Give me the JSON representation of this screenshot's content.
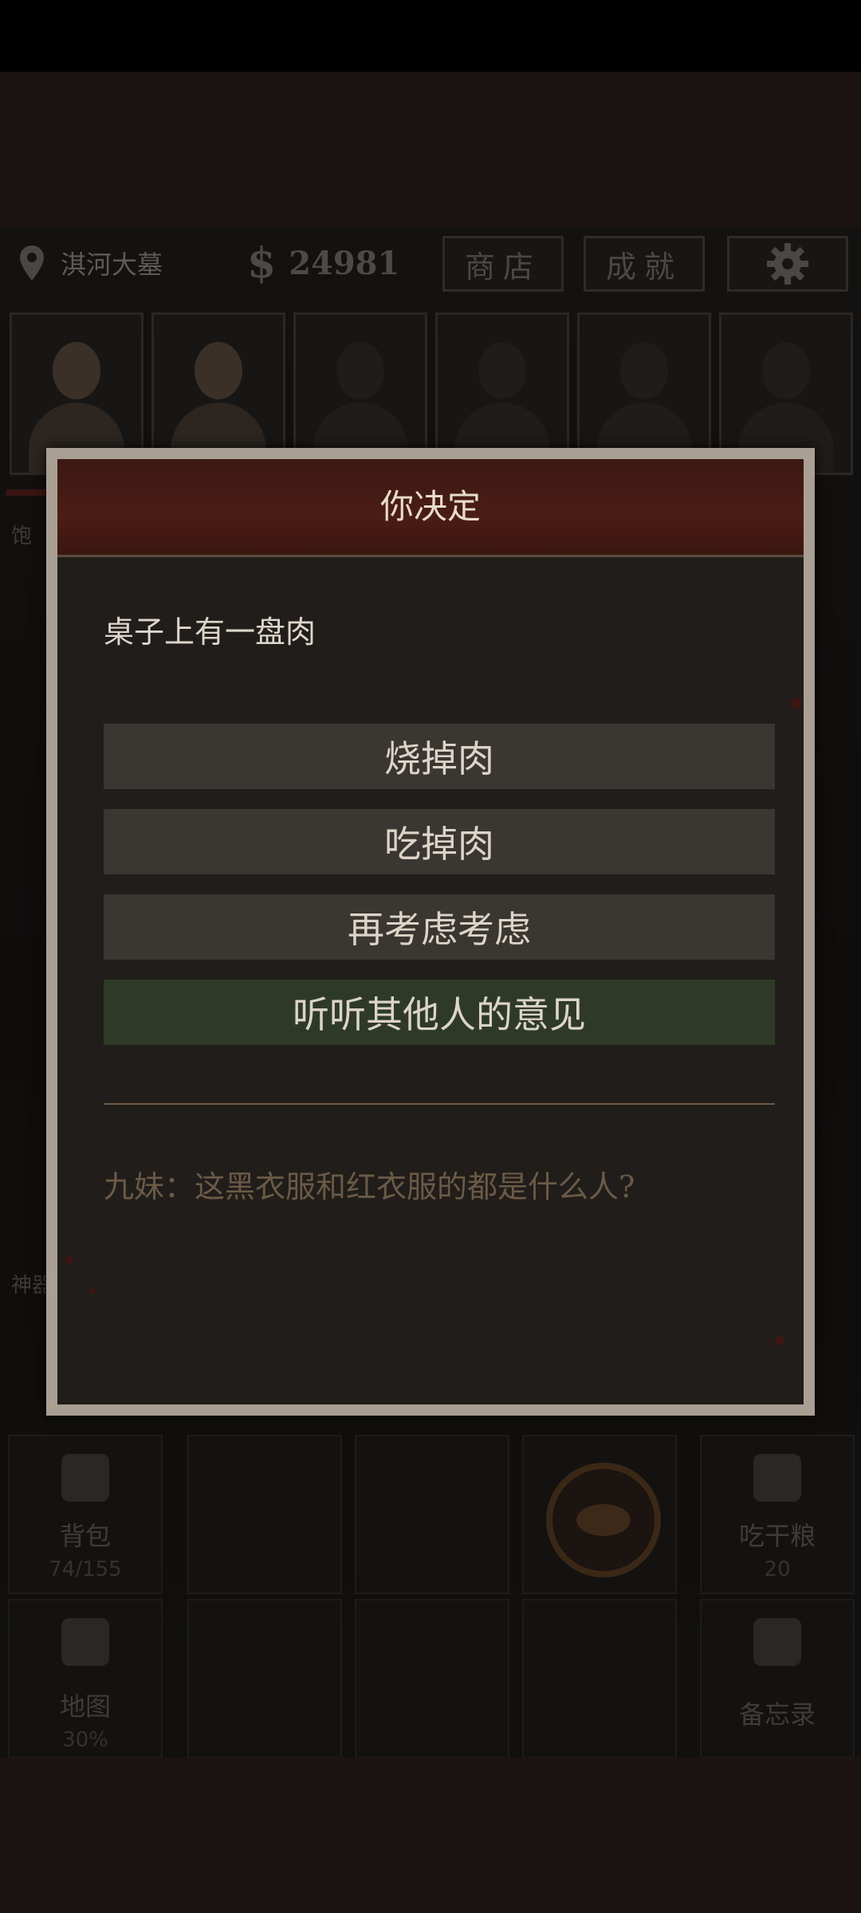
{
  "hud": {
    "location": "淇河大墓",
    "money_symbol": "$",
    "money": "24981",
    "shop_label": "商店",
    "achievements_label": "成就",
    "settings_icon": "gear-icon"
  },
  "portraits": [
    {
      "filled": true
    },
    {
      "filled": true
    },
    {
      "filled": false
    },
    {
      "filled": false
    },
    {
      "filled": false
    },
    {
      "filled": false
    }
  ],
  "side": {
    "status_char": "饱",
    "artifact_label": "神器"
  },
  "dialog": {
    "title": "你决定",
    "prompt": "桌子上有一盘肉",
    "options": [
      {
        "label": "烧掉肉",
        "highlight": false
      },
      {
        "label": "吃掉肉",
        "highlight": false
      },
      {
        "label": "再考虑考虑",
        "highlight": false
      },
      {
        "label": "听听其他人的意见",
        "highlight": true
      }
    ],
    "hint": "九妹：这黑衣服和红衣服的都是什么人?"
  },
  "bottom": {
    "backpack_label": "背包",
    "backpack_count": "74/155",
    "eat_label": "吃干粮",
    "eat_count": "20",
    "map_label": "地图",
    "map_progress": "30%",
    "memo_label": "备忘录"
  },
  "colors": {
    "dialog_header": "#4a1d15",
    "option_bg": "#3a3632",
    "option_green": "#2e3a27",
    "dialog_frame": "#a99f92"
  }
}
